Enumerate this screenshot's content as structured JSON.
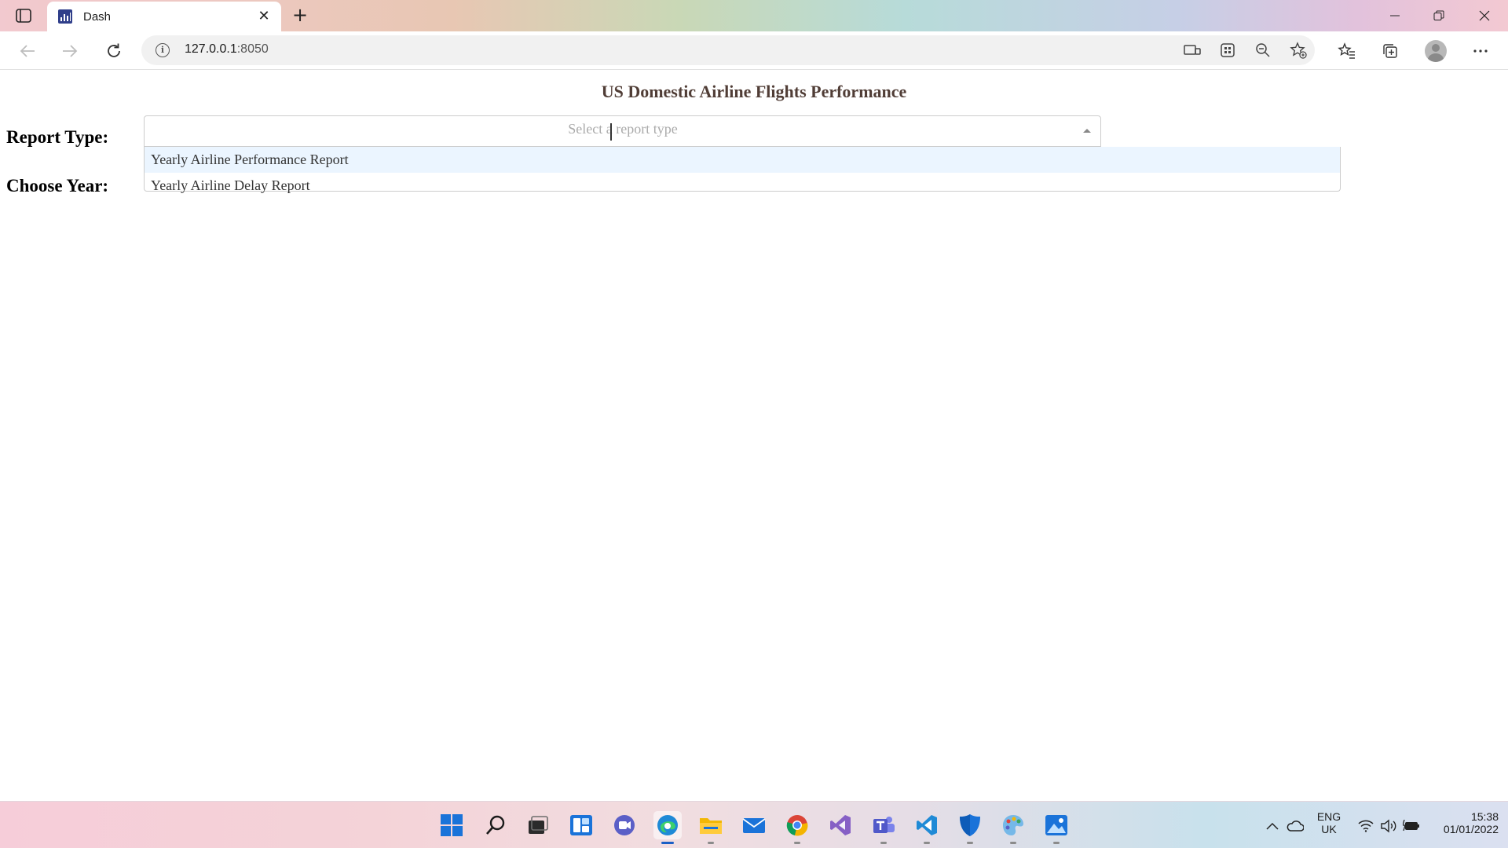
{
  "browser": {
    "tab_title": "Dash",
    "close_glyph": "✕",
    "new_tab_glyph": "+",
    "url_host": "127.0.0.1",
    "url_port": ":8050"
  },
  "page": {
    "title": "US Domestic Airline Flights Performance",
    "title_color": "#503d36",
    "report_type_label": "Report Type:",
    "choose_year_label": "Choose Year:",
    "report_dropdown": {
      "placeholder": "Select a report type",
      "is_open": true,
      "options": [
        {
          "label": "Yearly Airline Performance Report",
          "focused": true
        },
        {
          "label": "Yearly Airline Delay Report",
          "focused": false
        }
      ]
    }
  },
  "taskbar": {
    "apps": [
      "start-icon",
      "search-icon",
      "task-view-icon",
      "widgets-icon",
      "chat-icon",
      "edge-icon",
      "file-explorer-icon",
      "mail-icon",
      "chrome-icon",
      "visual-studio-icon",
      "teams-icon",
      "vscode-icon",
      "defender-icon",
      "paint-icon",
      "photos-icon"
    ],
    "active_app": "edge-icon",
    "language": "ENG",
    "region": "UK",
    "time": "15:38",
    "date": "01/01/2022"
  }
}
